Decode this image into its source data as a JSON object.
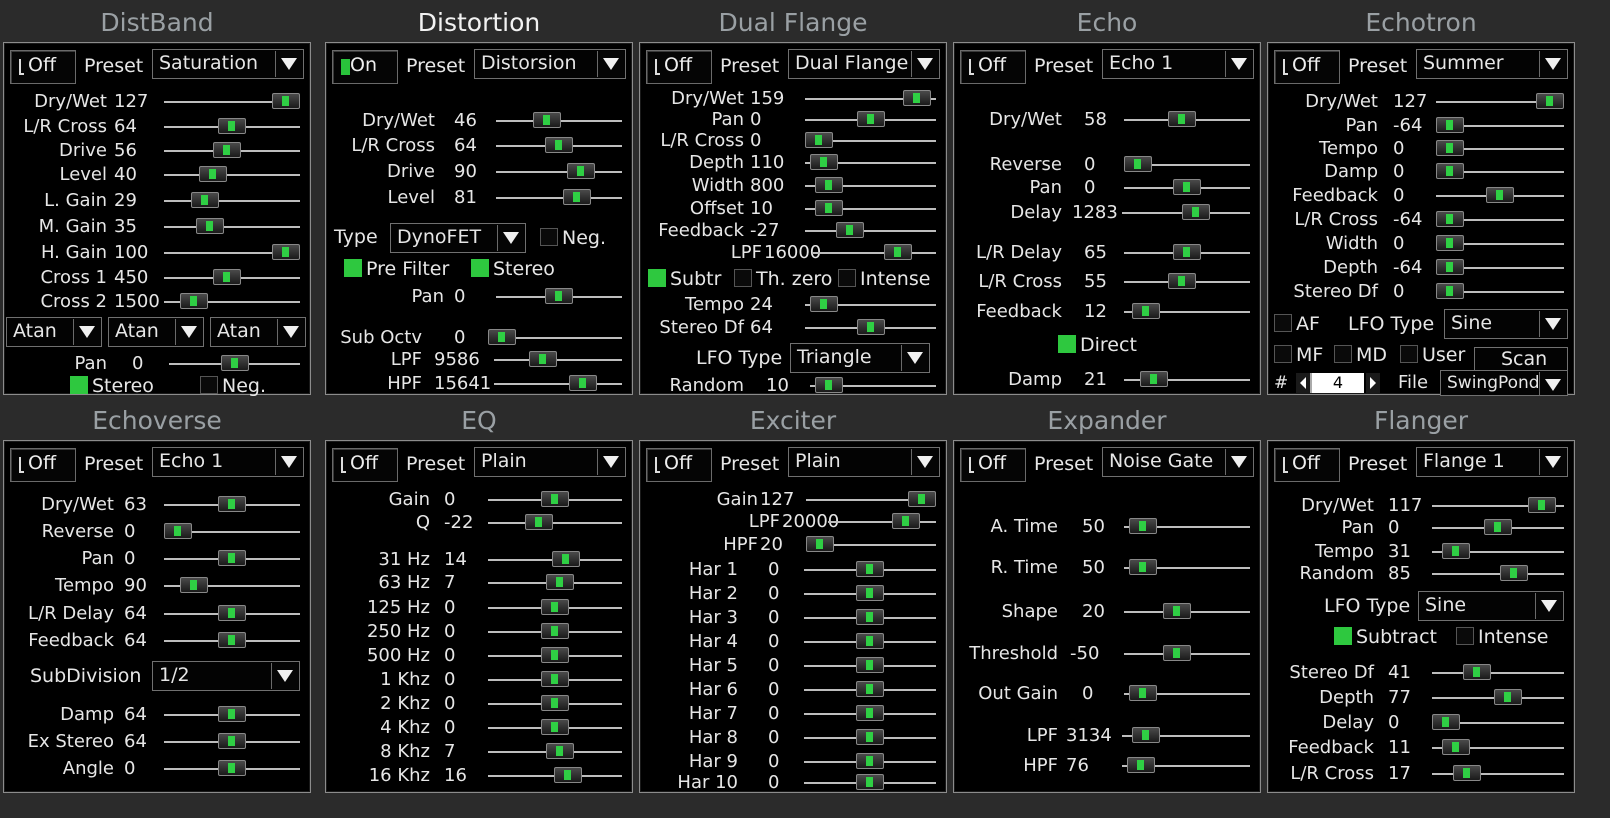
{
  "ui": {
    "preset_label": "Preset"
  },
  "panels": [
    {
      "title": "DistBand",
      "state": "Off",
      "preset": "Saturation",
      "sliders": [
        {
          "label": "Dry/Wet",
          "value": "127",
          "pos": 1.0
        },
        {
          "label": "L/R Cross",
          "value": "64",
          "pos": 0.5
        },
        {
          "label": "Drive",
          "value": "56",
          "pos": 0.45
        },
        {
          "label": "Level",
          "value": "40",
          "pos": 0.32
        },
        {
          "label": "L. Gain",
          "value": "29",
          "pos": 0.25
        },
        {
          "label": "M. Gain",
          "value": "35",
          "pos": 0.3
        },
        {
          "label": "H. Gain",
          "value": "100",
          "pos": 1.0
        },
        {
          "label": "Cross 1",
          "value": "450",
          "pos": 0.45
        },
        {
          "label": "Cross 2",
          "value": "1500",
          "pos": 0.15
        }
      ],
      "selects": [
        "Atan",
        "Atan",
        "Atan"
      ],
      "pan": {
        "label": "Pan",
        "value": "0",
        "pos": 0.5
      },
      "checks": [
        {
          "label": "Stereo",
          "on": true
        },
        {
          "label": "Neg.",
          "on": false
        }
      ]
    },
    {
      "title": "Distortion",
      "state": "On",
      "preset": "Distorsion",
      "sliders": [
        {
          "label": "Dry/Wet",
          "value": "46",
          "pos": 0.38
        },
        {
          "label": "L/R Cross",
          "value": "64",
          "pos": 0.5
        },
        {
          "label": "Drive",
          "value": "90",
          "pos": 0.72
        },
        {
          "label": "Level",
          "value": "81",
          "pos": 0.68
        }
      ],
      "type_label": "Type",
      "type_value": "DynoFET",
      "neg_label": "Neg.",
      "prefilter": "Pre Filter",
      "stereo": "Stereo",
      "sliders2": [
        {
          "label": "Pan",
          "value": "0",
          "pos": 0.5
        },
        {
          "label": "Sub Octv",
          "value": "0",
          "pos": 0.0
        },
        {
          "label": "LPF",
          "value": "9586",
          "pos": 0.35
        },
        {
          "label": "HPF",
          "value": "15641",
          "pos": 0.75
        }
      ]
    },
    {
      "title": "Dual Flange",
      "state": "Off",
      "preset": "Dual Flange",
      "sliders": [
        {
          "label": "Dry/Wet",
          "value": "159",
          "pos": 0.95
        },
        {
          "label": "Pan",
          "value": "0",
          "pos": 0.5
        },
        {
          "label": "L/R Cross",
          "value": "0",
          "pos": 0.0
        },
        {
          "label": "Depth",
          "value": "110",
          "pos": 0.05
        },
        {
          "label": "Width",
          "value": "800",
          "pos": 0.1
        },
        {
          "label": "Offset",
          "value": "10",
          "pos": 0.1
        },
        {
          "label": "Feedback",
          "value": "-27",
          "pos": 0.3
        }
      ],
      "lpf": {
        "label": "LPF",
        "value": "16000",
        "pos": 0.75
      },
      "checks": [
        {
          "label": "Subtr",
          "on": true
        },
        {
          "label": "Th. zero",
          "on": false
        },
        {
          "label": "Intense",
          "on": false
        }
      ],
      "sliders2": [
        {
          "label": "Tempo",
          "value": "24",
          "pos": 0.05
        },
        {
          "label": "Stereo Df",
          "value": "64",
          "pos": 0.5
        }
      ],
      "lfo_label": "LFO Type",
      "lfo_value": "Triangle",
      "random": {
        "label": "Random",
        "value": "10",
        "pos": 0.05
      }
    },
    {
      "title": "Echo",
      "state": "Off",
      "preset": "Echo 1",
      "sliders": [
        {
          "label": "Dry/Wet",
          "value": "58",
          "pos": 0.45
        },
        {
          "label": "Reverse",
          "value": "0",
          "pos": 0.0
        },
        {
          "label": "Pan",
          "value": "0",
          "pos": 0.5
        },
        {
          "label": "Delay",
          "value": "1283",
          "pos": 0.6
        },
        {
          "label": "L/R Delay",
          "value": "65",
          "pos": 0.5
        },
        {
          "label": "L/R Cross",
          "value": "55",
          "pos": 0.45
        },
        {
          "label": "Feedback",
          "value": "12",
          "pos": 0.08
        }
      ],
      "direct": "Direct",
      "damp": {
        "label": "Damp",
        "value": "21",
        "pos": 0.16
      }
    },
    {
      "title": "Echotron",
      "state": "Off",
      "preset": "Summer",
      "sliders": [
        {
          "label": "Dry/Wet",
          "value": "127",
          "pos": 1.0
        },
        {
          "label": "Pan",
          "value": "-64",
          "pos": 0.0
        },
        {
          "label": "Tempo",
          "value": "0",
          "pos": 0.0
        },
        {
          "label": "Damp",
          "value": "0",
          "pos": 0.0
        },
        {
          "label": "Feedback",
          "value": "0",
          "pos": 0.5
        },
        {
          "label": "L/R Cross",
          "value": "-64",
          "pos": 0.0
        },
        {
          "label": "Width",
          "value": "0",
          "pos": 0.0
        },
        {
          "label": "Depth",
          "value": "-64",
          "pos": 0.0
        },
        {
          "label": "Stereo Df",
          "value": "0",
          "pos": 0.0
        }
      ],
      "af": "AF",
      "lfo_label": "LFO Type",
      "lfo_value": "Sine",
      "mf": "MF",
      "md": "MD",
      "user": "User",
      "scan": "Scan",
      "hash": "#",
      "taps": "4",
      "file_label": "File",
      "file_value": "SwingPond"
    },
    {
      "title": "Echoverse",
      "state": "Off",
      "preset": "Echo 1",
      "sliders": [
        {
          "label": "Dry/Wet",
          "value": "63",
          "pos": 0.5
        },
        {
          "label": "Reverse",
          "value": "0",
          "pos": 0.0
        },
        {
          "label": "Pan",
          "value": "0",
          "pos": 0.5
        },
        {
          "label": "Tempo",
          "value": "90",
          "pos": 0.15
        },
        {
          "label": "L/R Delay",
          "value": "64",
          "pos": 0.5
        },
        {
          "label": "Feedback",
          "value": "64",
          "pos": 0.5
        }
      ],
      "subdiv_label": "SubDivision",
      "subdiv_value": "1/2",
      "sliders2": [
        {
          "label": "Damp",
          "value": "64",
          "pos": 0.5
        },
        {
          "label": "Ex Stereo",
          "value": "64",
          "pos": 0.5
        },
        {
          "label": "Angle",
          "value": "0",
          "pos": 0.5
        }
      ]
    },
    {
      "title": "EQ",
      "state": "Off",
      "preset": "Plain",
      "sliders": [
        {
          "label": "Gain",
          "value": "0",
          "pos": 0.5
        },
        {
          "label": "Q",
          "value": "-22",
          "pos": 0.35
        },
        {
          "label": "31 Hz",
          "value": "14",
          "pos": 0.6
        },
        {
          "label": "63 Hz",
          "value": "7",
          "pos": 0.55
        },
        {
          "label": "125 Hz",
          "value": "0",
          "pos": 0.5
        },
        {
          "label": "250 Hz",
          "value": "0",
          "pos": 0.5
        },
        {
          "label": "500 Hz",
          "value": "0",
          "pos": 0.5
        },
        {
          "label": "1 Khz",
          "value": "0",
          "pos": 0.5
        },
        {
          "label": "2 Khz",
          "value": "0",
          "pos": 0.5
        },
        {
          "label": "4 Khz",
          "value": "0",
          "pos": 0.5
        },
        {
          "label": "8 Khz",
          "value": "7",
          "pos": 0.55
        },
        {
          "label": "16 Khz",
          "value": "16",
          "pos": 0.62
        }
      ]
    },
    {
      "title": "Exciter",
      "state": "Off",
      "preset": "Plain",
      "sliders": [
        {
          "label": "Gain",
          "value": "127",
          "pos": 1.0
        },
        {
          "label": "LPF",
          "value": "20000",
          "pos": 0.8
        },
        {
          "label": "HPF",
          "value": "20",
          "pos": 0.0
        },
        {
          "label": "Har 1",
          "value": "0",
          "pos": 0.5
        },
        {
          "label": "Har 2",
          "value": "0",
          "pos": 0.5
        },
        {
          "label": "Har 3",
          "value": "0",
          "pos": 0.5
        },
        {
          "label": "Har 4",
          "value": "0",
          "pos": 0.5
        },
        {
          "label": "Har 5",
          "value": "0",
          "pos": 0.5
        },
        {
          "label": "Har 6",
          "value": "0",
          "pos": 0.5
        },
        {
          "label": "Har 7",
          "value": "0",
          "pos": 0.5
        },
        {
          "label": "Har 8",
          "value": "0",
          "pos": 0.5
        },
        {
          "label": "Har 9",
          "value": "0",
          "pos": 0.5
        },
        {
          "label": "Har 10",
          "value": "0",
          "pos": 0.5
        }
      ]
    },
    {
      "title": "Expander",
      "state": "Off",
      "preset": "Noise Gate",
      "sliders": [
        {
          "label": "A. Time",
          "value": "50",
          "pos": 0.05
        },
        {
          "label": "R. Time",
          "value": "50",
          "pos": 0.05
        },
        {
          "label": "Shape",
          "value": "20",
          "pos": 0.4
        },
        {
          "label": "Threshold",
          "value": "-50",
          "pos": 0.4
        },
        {
          "label": "Out Gain",
          "value": "0",
          "pos": 0.05
        },
        {
          "label": "LPF",
          "value": "3134",
          "pos": 0.1
        },
        {
          "label": "HPF",
          "value": "76",
          "pos": 0.05
        }
      ]
    },
    {
      "title": "Flanger",
      "state": "Off",
      "preset": "Flange 1",
      "sliders": [
        {
          "label": "Dry/Wet",
          "value": "117",
          "pos": 0.92
        },
        {
          "label": "Pan",
          "value": "0",
          "pos": 0.5
        },
        {
          "label": "Tempo",
          "value": "31",
          "pos": 0.1
        },
        {
          "label": "Random",
          "value": "85",
          "pos": 0.65
        }
      ],
      "lfo_label": "LFO Type",
      "lfo_value": "Sine",
      "checks": [
        {
          "label": "Subtract",
          "on": true
        },
        {
          "label": "Intense",
          "on": false
        }
      ],
      "sliders2": [
        {
          "label": "Stereo Df",
          "value": "41",
          "pos": 0.3
        },
        {
          "label": "Depth",
          "value": "77",
          "pos": 0.6
        },
        {
          "label": "Delay",
          "value": "0",
          "pos": 0.0
        },
        {
          "label": "Feedback",
          "value": "11",
          "pos": 0.1
        },
        {
          "label": "L/R Cross",
          "value": "17",
          "pos": 0.2
        }
      ]
    }
  ]
}
